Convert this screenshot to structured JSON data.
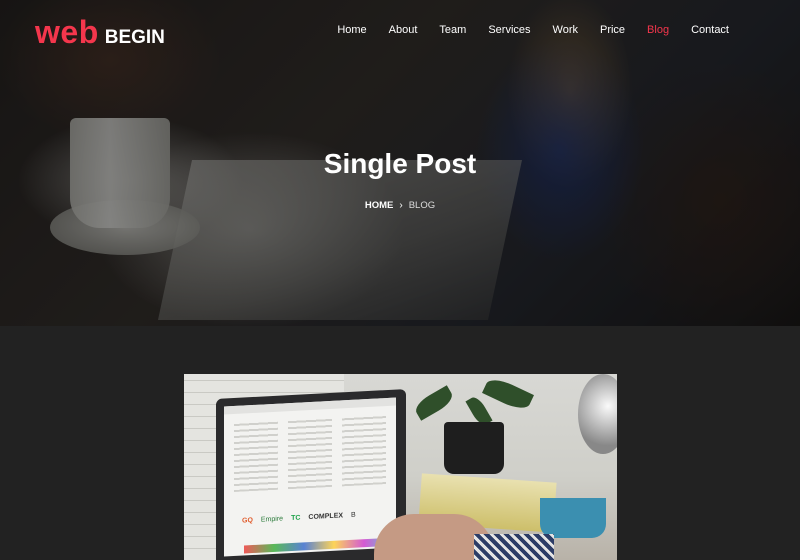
{
  "brand": {
    "logo_primary": "web",
    "logo_secondary": "BEGIN",
    "accent_color": "#f4364c"
  },
  "nav": {
    "items": [
      {
        "label": "Home"
      },
      {
        "label": "About"
      },
      {
        "label": "Team"
      },
      {
        "label": "Services"
      },
      {
        "label": "Work"
      },
      {
        "label": "Price"
      },
      {
        "label": "Blog",
        "active": true
      },
      {
        "label": "Contact"
      }
    ]
  },
  "hero": {
    "title": "Single Post",
    "breadcrumb": {
      "home": "HOME",
      "separator": "›",
      "current": "BLOG"
    }
  },
  "post": {
    "image_logos": [
      "GQ",
      "Empire",
      "TC",
      "COMPLEX",
      "B"
    ]
  }
}
